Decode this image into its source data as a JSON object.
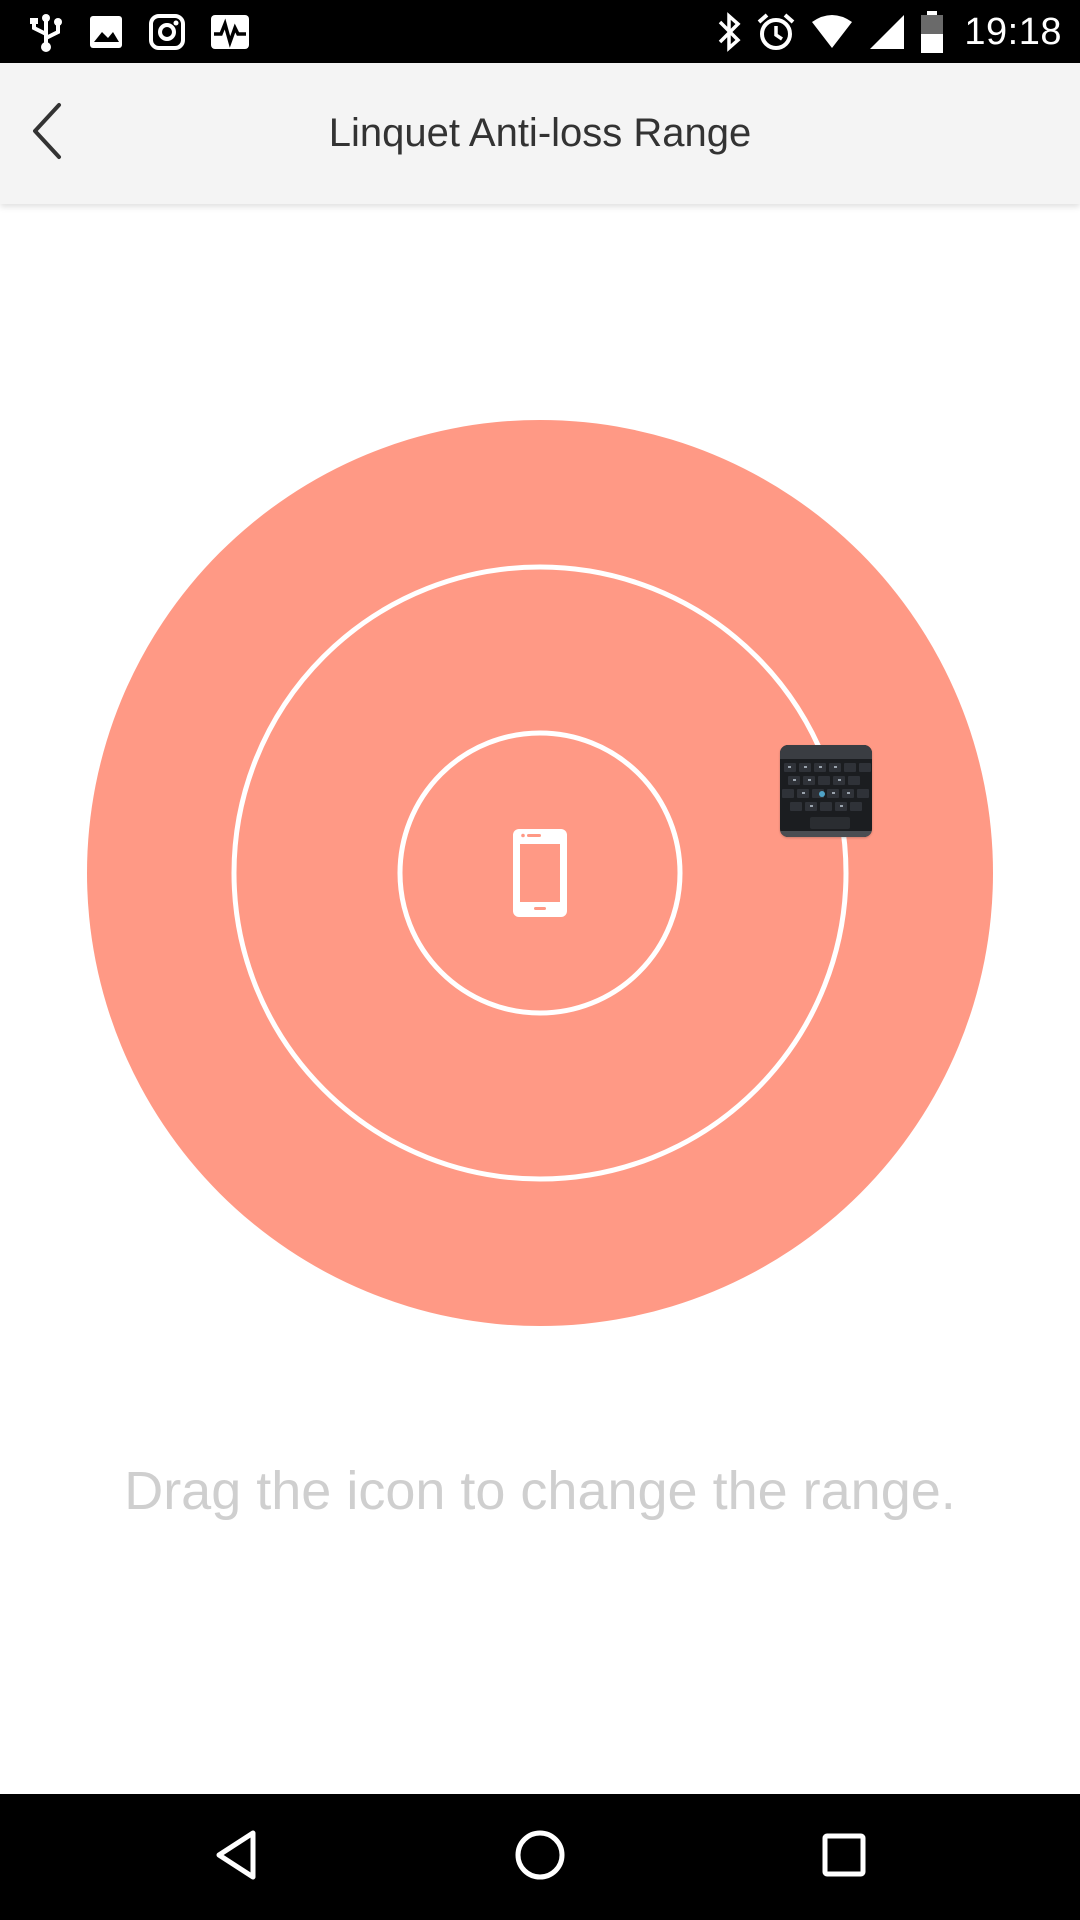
{
  "status_bar": {
    "time": "19:18",
    "left_icons": [
      "usb-icon",
      "image-icon",
      "instagram-icon",
      "activity-icon"
    ],
    "right_icons": [
      "bluetooth-icon",
      "alarm-icon",
      "wifi-icon",
      "signal-icon",
      "battery-icon"
    ]
  },
  "app_bar": {
    "title": "Linquet Anti-loss Range",
    "back_icon": "chevron-left-icon"
  },
  "range": {
    "ring_color": "#ff9985",
    "ring_line_color": "#ffffff",
    "center_icon": "smartphone-icon",
    "device_icon": "keyboard-thumbnail"
  },
  "hint": {
    "text": "Drag the icon to change the range."
  },
  "nav_bar": {
    "buttons": [
      "back-triangle-icon",
      "home-circle-icon",
      "recents-square-icon"
    ]
  }
}
